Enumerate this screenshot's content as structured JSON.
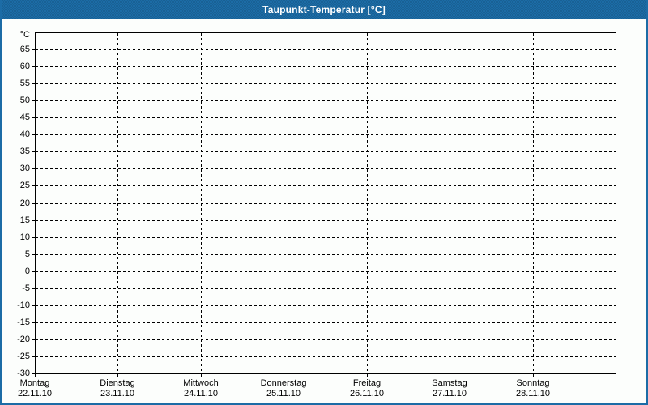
{
  "window": {
    "title": "Taupunkt-Temperatur [°C]"
  },
  "colors": {
    "titlebar": "#1C6CA6",
    "frame": "#1C6CA6",
    "background": "#FCFEFC",
    "grid_lines": "#000000",
    "title_text": "#FFFFFF",
    "axis_text": "#000000"
  },
  "chart_data": {
    "type": "line",
    "title": "Taupunkt-Temperatur [°C]",
    "xlabel": "",
    "ylabel": "°C",
    "ylim": [
      -30,
      70
    ],
    "ytick_step": 5,
    "yticks": [
      65,
      60,
      55,
      50,
      45,
      40,
      35,
      30,
      25,
      20,
      15,
      10,
      5,
      0,
      -5,
      -10,
      -15,
      -20,
      -25,
      -30
    ],
    "categories": [
      "Montag",
      "Dienstag",
      "Mittwoch",
      "Donnerstag",
      "Freitag",
      "Samstag",
      "Sonntag"
    ],
    "category_dates": [
      "22.11.10",
      "23.11.10",
      "24.11.10",
      "25.11.10",
      "26.11.10",
      "27.11.10",
      "28.11.10"
    ],
    "series": [],
    "grid": "dashed",
    "legend": "none"
  }
}
